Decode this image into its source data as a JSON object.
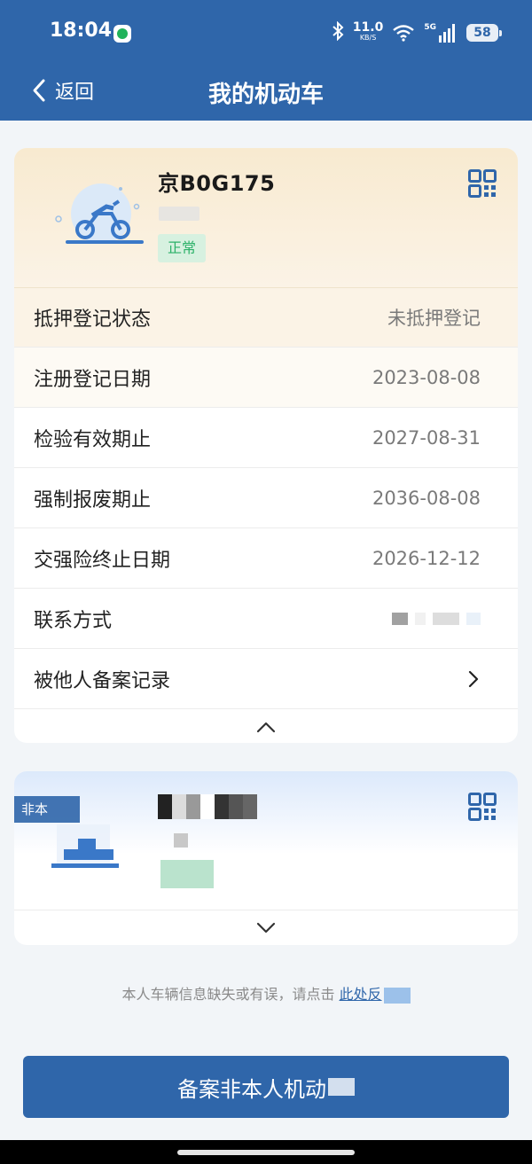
{
  "status_bar": {
    "time": "18:04",
    "speed_value": "11.0",
    "speed_unit": "KB/S",
    "network": "5G",
    "battery": "58",
    "icons": [
      "app-notification-icon",
      "bluetooth-icon",
      "wifi-icon",
      "signal-icon",
      "battery-icon"
    ]
  },
  "nav": {
    "back_label": "返回",
    "title": "我的机动车"
  },
  "vehicle_1": {
    "plate": "京B0G175",
    "status_tag": "正常",
    "rows": [
      {
        "label": "抵押登记状态",
        "value": "未抵押登记"
      },
      {
        "label": "注册登记日期",
        "value": "2023-08-08"
      },
      {
        "label": "检验有效期止",
        "value": "2027-08-31"
      },
      {
        "label": "强制报废期止",
        "value": "2036-08-08"
      },
      {
        "label": "交强险终止日期",
        "value": "2026-12-12"
      },
      {
        "label": "联系方式",
        "value": ""
      },
      {
        "label": "被他人备案记录",
        "value": ""
      }
    ]
  },
  "vehicle_2": {
    "badge": "非本"
  },
  "footer": {
    "text": "本人车辆信息缺失或有误，请点击",
    "link": "此处反"
  },
  "main_button": {
    "label": "备案非本人机动"
  },
  "colors": {
    "primary": "#2f66aa",
    "status_green": "#2bb168",
    "header_warm": "#f8ead0"
  }
}
